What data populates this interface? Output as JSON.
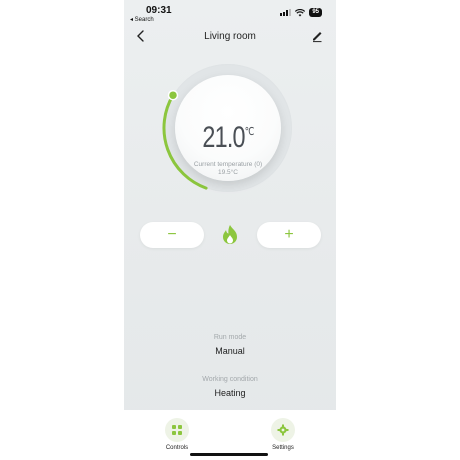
{
  "status_bar": {
    "time": "09:31",
    "back_app": "◂ Search",
    "battery": "95"
  },
  "nav": {
    "title": "Living room"
  },
  "dial": {
    "setpoint": "21.0",
    "unit": "℃",
    "current_label": "Current temperature (0)",
    "current_value": "19.5°C",
    "arc_progress": 0.28
  },
  "controls": {
    "minus": "−",
    "plus": "+"
  },
  "info": {
    "run_mode_label": "Run mode",
    "run_mode_value": "Manual",
    "working_label": "Working condition",
    "working_value": "Heating"
  },
  "tabs": [
    {
      "label": "Controls"
    },
    {
      "label": "Settings"
    }
  ],
  "colors": {
    "accent": "#8cc63e",
    "flame": "#8cc63e"
  }
}
